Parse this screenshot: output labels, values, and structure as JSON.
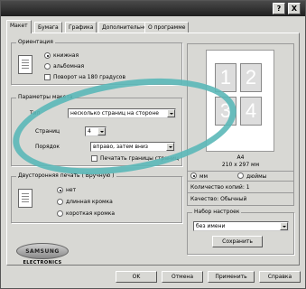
{
  "window": {
    "help_btn": "?",
    "close_btn": "X"
  },
  "tabs": [
    "Макет",
    "Бумага",
    "Графика",
    "Дополнительно",
    "О программе"
  ],
  "orientation": {
    "title": "Ориентация",
    "options": [
      "книжная",
      "альбомная",
      "Поворот на 180 градусов"
    ],
    "selected": 0
  },
  "layout": {
    "title": "Параметры макета",
    "type_label": "Тип",
    "type_value": "несколько страниц на стороне",
    "pages_label": "Страниц",
    "pages_value": "4",
    "order_label": "Порядок",
    "order_value": "вправо, затем вниз",
    "border_label": "Печатать границы страниц"
  },
  "duplex": {
    "title": "Двусторонняя печать ( Вручную )",
    "options": [
      "нет",
      "длинная кромка",
      "короткая кромка"
    ],
    "selected": 0
  },
  "preview": {
    "page_numbers": [
      "1",
      "2",
      "3",
      "4"
    ],
    "paper_name": "A4",
    "paper_size": "210 x 297 мм",
    "unit_options": [
      "мм",
      "дюймы"
    ],
    "unit_selected": 0,
    "copies_label": "Количество копий: 1",
    "quality_label": "Качество: Обычный"
  },
  "presets": {
    "title": "Набор настроек",
    "value": "без имени",
    "save_label": "Сохранить"
  },
  "logo": {
    "brand": "SAMSUNG",
    "sub": "ELECTRONICS"
  },
  "footer": {
    "ok": "OK",
    "cancel": "Отмена",
    "apply": "Применить",
    "help": "Справка"
  }
}
